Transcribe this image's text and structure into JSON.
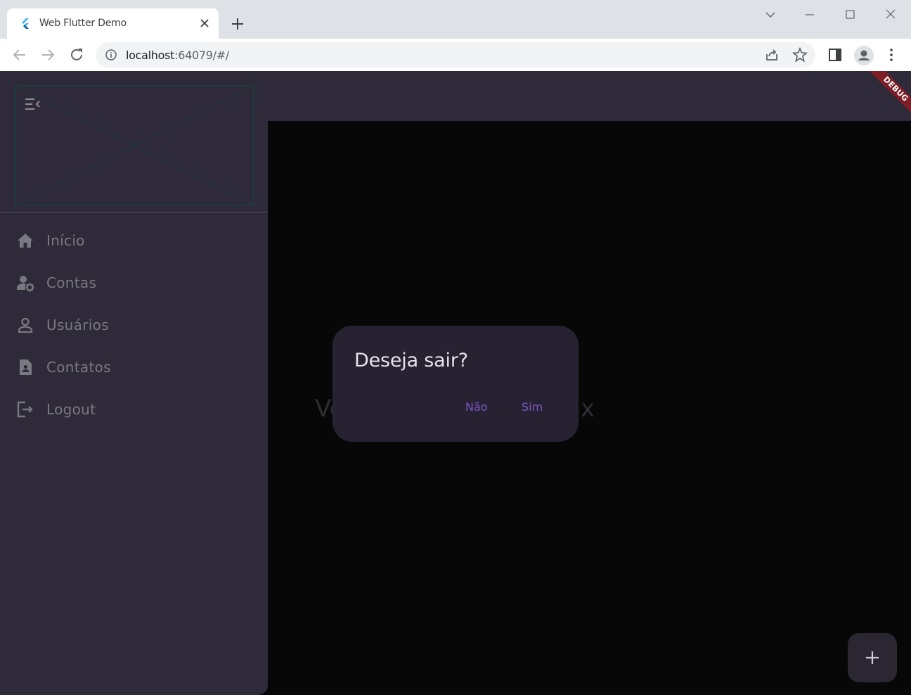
{
  "browser": {
    "tab_title": "Web Flutter Demo",
    "url_host": "localhost",
    "url_rest": ":64079/#/"
  },
  "app": {
    "debug_banner": "DEBUG",
    "background_text_left": "Vo",
    "background_text_right": "x"
  },
  "drawer": {
    "items": [
      {
        "label": "Início",
        "icon": "home-icon"
      },
      {
        "label": "Contas",
        "icon": "manage-accounts-icon"
      },
      {
        "label": "Usuários",
        "icon": "person-icon"
      },
      {
        "label": "Contatos",
        "icon": "contact-page-icon"
      },
      {
        "label": "Logout",
        "icon": "logout-icon"
      }
    ]
  },
  "dialog": {
    "title": "Deseja sair?",
    "no_label": "Não",
    "yes_label": "Sim"
  },
  "colors": {
    "appbar": "#2e2a39",
    "drawer": "#2e2a39",
    "dialog": "#272231",
    "accent": "#7c55c7",
    "debug": "#7d1e26"
  }
}
